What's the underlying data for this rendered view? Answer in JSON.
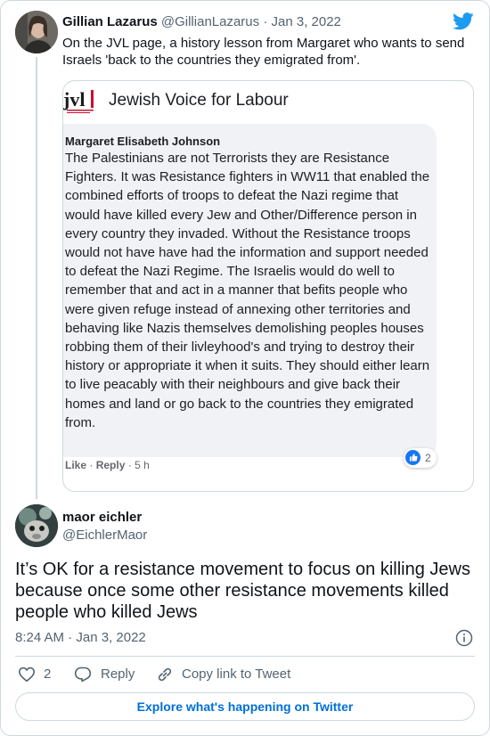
{
  "tweet1": {
    "name": "Gillian Lazarus",
    "handle": "@GillianLazarus",
    "separator": "·",
    "date": "Jan 3, 2022",
    "text": "On the JVL page, a history lesson from Margaret who wants to send Israels 'back to the countries they emigrated from'."
  },
  "embedded": {
    "logo_text": "jvl",
    "page_title": "Jewish Voice for Labour",
    "comment_author": "Margaret Elisabeth Johnson",
    "comment_text": "The Palestinians are not Terrorists they are Resistance Fighters. It was Resistance fighters in WW11 that enabled the combined efforts of troops to defeat the Nazi regime that would have killed every Jew and Other/Difference person in every country they invaded. Without the Resistance troops would not have have had the information and support needed to defeat the Nazi Regime. The Israelis would do well to remember that and act in a manner that befits people who were given refuge instead of annexing other territories and behaving like Nazis themselves demolishing peoples houses robbing them of their livleyhood's and trying to destroy their history or appropriate it when it suits. They should either learn to live peacably with their neighbours and give back their homes and land or go back to the countries they emigrated from.",
    "like_label": "Like",
    "dot": "·",
    "reply_label": "Reply",
    "age": "5 h",
    "reaction_count": "2"
  },
  "tweet2": {
    "name": "maor eichler",
    "handle": "@EichlerMaor",
    "text": "It’s OK for a resistance movement to focus on killing Jews because once some other resistance movements killed people who killed Jews",
    "timestamp": "8:24 AM · Jan 3, 2022",
    "likes": "2",
    "reply_label": "Reply",
    "copy_link_label": "Copy link to Tweet"
  },
  "footer": {
    "explore_label": "Explore what's happening on Twitter"
  },
  "colors": {
    "twitter_blue": "#1d9bf0",
    "link_blue": "#006fd6",
    "facebook_blue": "#1877f2",
    "jvl_red": "#c8102e"
  },
  "icons": [
    "twitter-bird-icon",
    "info-icon",
    "heart-icon",
    "reply-icon",
    "link-icon",
    "like-reaction-icon"
  ]
}
